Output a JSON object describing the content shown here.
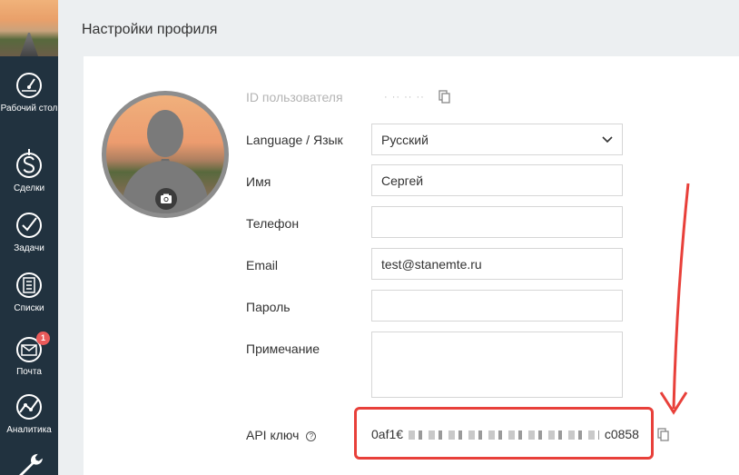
{
  "sidebar": {
    "items": [
      {
        "label": "Рабочий стол",
        "icon": "dashboard-icon"
      },
      {
        "label": "Сделки",
        "icon": "dollar-icon"
      },
      {
        "label": "Задачи",
        "icon": "check-circle-icon"
      },
      {
        "label": "Списки",
        "icon": "list-icon"
      },
      {
        "label": "Почта",
        "icon": "mail-icon",
        "badge": "1"
      },
      {
        "label": "Аналитика",
        "icon": "analytics-icon"
      },
      {
        "label": "",
        "icon": "wrench-icon"
      }
    ]
  },
  "header": {
    "title": "Настройки профиля"
  },
  "form": {
    "user_id_label": "ID пользователя",
    "user_id_value": "· ·· ·· ··",
    "language_label": "Language / Язык",
    "language_value": "Русский",
    "name_label": "Имя",
    "name_value": "Сергей",
    "phone_label": "Телефон",
    "phone_value": "",
    "email_label": "Email",
    "email_value": "test@stanemte.ru",
    "password_label": "Пароль",
    "password_value": "",
    "note_label": "Примечание",
    "note_value": "",
    "api_label": "API ключ",
    "api_value_start": "0af1€",
    "api_value_end": "c0858"
  },
  "colors": {
    "sidebar_bg": "#21323f",
    "highlight": "#e8403a",
    "badge": "#ea5a5a"
  }
}
